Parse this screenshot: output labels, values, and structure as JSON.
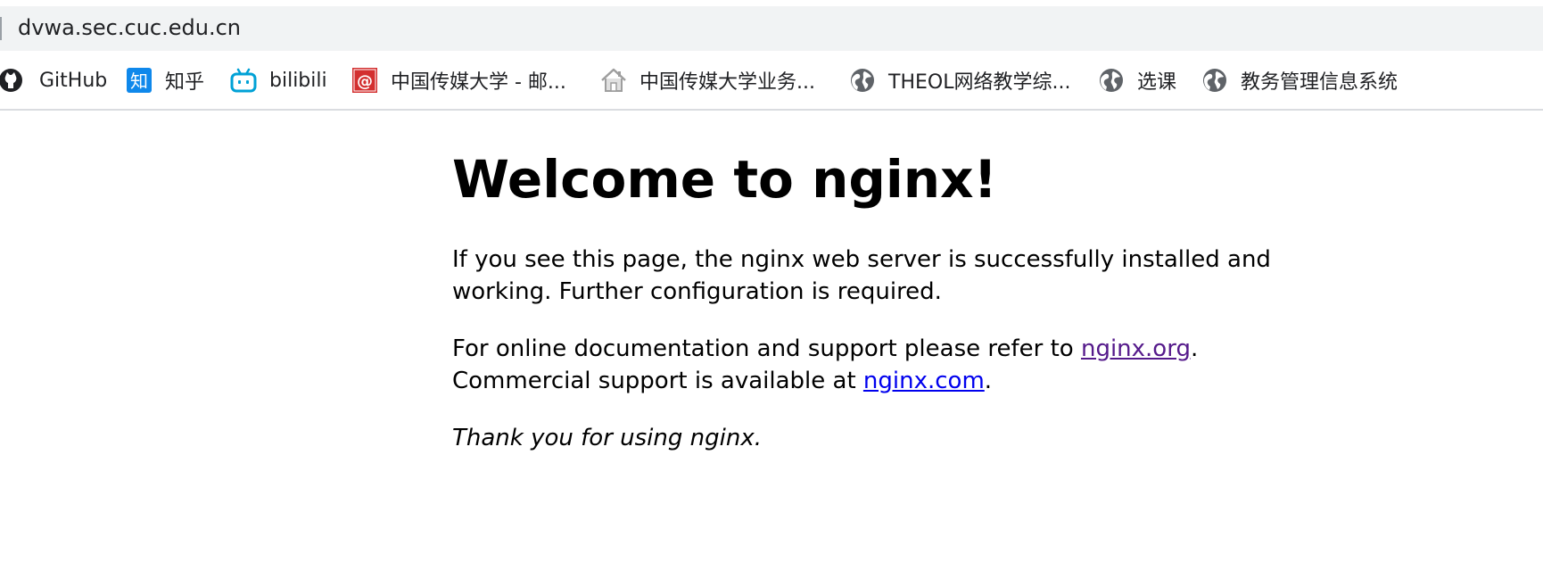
{
  "address_bar": {
    "url": "dvwa.sec.cuc.edu.cn"
  },
  "bookmarks": [
    {
      "label": "GitHub",
      "icon": "github-icon"
    },
    {
      "label": "知乎",
      "icon": "zhihu-icon"
    },
    {
      "label": "bilibili",
      "icon": "bilibili-icon"
    },
    {
      "label": "中国传媒大学 - 邮...",
      "icon": "mail-icon"
    },
    {
      "label": "中国传媒大学业务...",
      "icon": "home-icon"
    },
    {
      "label": "THEOL网络教学综...",
      "icon": "globe-icon"
    },
    {
      "label": "选课",
      "icon": "globe-icon"
    },
    {
      "label": "教务管理信息系统",
      "icon": "globe-icon"
    }
  ],
  "page": {
    "heading": "Welcome to nginx!",
    "para1": "If you see this page, the nginx web server is successfully installed and working. Further configuration is required.",
    "para2_prefix": "For online documentation and support please refer to ",
    "para2_link": "nginx.org",
    "para2_suffix": ".",
    "para3_prefix": "Commercial support is available at ",
    "para3_link": "nginx.com",
    "para3_suffix": ".",
    "thanks": "Thank you for using nginx."
  },
  "colors": {
    "visited_link": "#551a8b",
    "unvisited_link": "#0000ee",
    "zhihu_blue": "#0f88eb",
    "bilibili_blue": "#00a1d6",
    "mail_red": "#d32f2f"
  }
}
